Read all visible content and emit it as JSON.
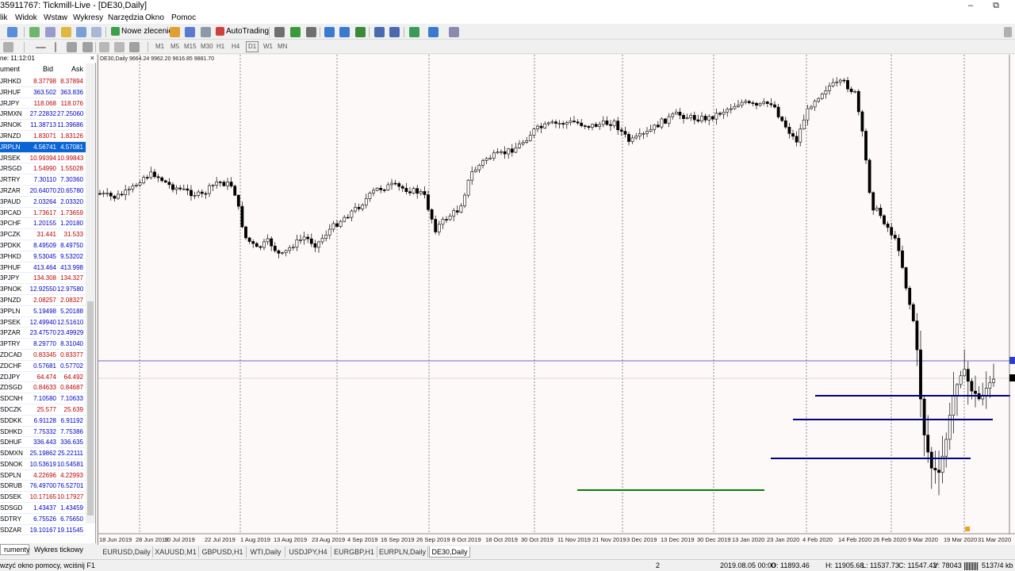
{
  "window": {
    "title": "35911767: Tickmill-Live - [DE30,Daily]",
    "minimize": "–",
    "maximize": "⧉"
  },
  "menu": [
    "lik",
    "Widok",
    "Wstaw",
    "Wykresy",
    "Narzędzia",
    "Okno",
    "Pomoc"
  ],
  "toolbar": {
    "new_order": "Nowe zlecenie",
    "autotrading": "AutoTrading",
    "timeframes": [
      "M1",
      "M5",
      "M15",
      "M30",
      "H1",
      "H4",
      "D1",
      "W1",
      "MN"
    ]
  },
  "market_watch": {
    "header": "ne: 11:12:01",
    "close": "×",
    "col_symbol": "ument",
    "col_bid": "Bid",
    "col_ask": "Ask",
    "rows": [
      {
        "symbol": "JRHKD",
        "bid": "8.37798",
        "ask": "8.37894",
        "dir": "down"
      },
      {
        "symbol": "JRHUF",
        "bid": "363.502",
        "ask": "363.836",
        "dir": "up"
      },
      {
        "symbol": "JRJPY",
        "bid": "118.068",
        "ask": "118.076",
        "dir": "down"
      },
      {
        "symbol": "JRMXN",
        "bid": "27.22832",
        "ask": "27.25060",
        "dir": "up"
      },
      {
        "symbol": "JRNOK",
        "bid": "11.38713",
        "ask": "11.39686",
        "dir": "up"
      },
      {
        "symbol": "JRNZD",
        "bid": "1.83071",
        "ask": "1.83126",
        "dir": "down"
      },
      {
        "symbol": "JRPLN",
        "bid": "4.56741",
        "ask": "4.57081",
        "dir": "sel"
      },
      {
        "symbol": "JRSEK",
        "bid": "10.99394",
        "ask": "10.99843",
        "dir": "down"
      },
      {
        "symbol": "JRSGD",
        "bid": "1.54990",
        "ask": "1.55028",
        "dir": "down"
      },
      {
        "symbol": "JRTRY",
        "bid": "7.30110",
        "ask": "7.30360",
        "dir": "up"
      },
      {
        "symbol": "JRZAR",
        "bid": "20.64070",
        "ask": "20.65780",
        "dir": "up"
      },
      {
        "symbol": "3PAUD",
        "bid": "2.03264",
        "ask": "2.03320",
        "dir": "up"
      },
      {
        "symbol": "3PCAD",
        "bid": "1.73617",
        "ask": "1.73659",
        "dir": "down"
      },
      {
        "symbol": "3PCHF",
        "bid": "1.20155",
        "ask": "1.20180",
        "dir": "up"
      },
      {
        "symbol": "3PCZK",
        "bid": "31.441",
        "ask": "31.533",
        "dir": "down"
      },
      {
        "symbol": "3PDKK",
        "bid": "8.49509",
        "ask": "8.49750",
        "dir": "up"
      },
      {
        "symbol": "3PHKD",
        "bid": "9.53045",
        "ask": "9.53202",
        "dir": "up"
      },
      {
        "symbol": "3PHUF",
        "bid": "413.464",
        "ask": "413.998",
        "dir": "up"
      },
      {
        "symbol": "3PJPY",
        "bid": "134.308",
        "ask": "134.327",
        "dir": "down"
      },
      {
        "symbol": "3PNOK",
        "bid": "12.92550",
        "ask": "12.97580",
        "dir": "up"
      },
      {
        "symbol": "3PNZD",
        "bid": "2.08257",
        "ask": "2.08327",
        "dir": "down"
      },
      {
        "symbol": "3PPLN",
        "bid": "5.19498",
        "ask": "5.20188",
        "dir": "up"
      },
      {
        "symbol": "3PSEK",
        "bid": "12.49940",
        "ask": "12.51610",
        "dir": "up"
      },
      {
        "symbol": "3PZAR",
        "bid": "23.47570",
        "ask": "23.49929",
        "dir": "up"
      },
      {
        "symbol": "3PTRY",
        "bid": "8.29770",
        "ask": "8.31040",
        "dir": "up"
      },
      {
        "symbol": "ZDCAD",
        "bid": "0.83345",
        "ask": "0.83377",
        "dir": "down"
      },
      {
        "symbol": "ZDCHF",
        "bid": "0.57681",
        "ask": "0.57702",
        "dir": "up"
      },
      {
        "symbol": "ZDJPY",
        "bid": "64.474",
        "ask": "64.492",
        "dir": "down"
      },
      {
        "symbol": "ZDSGD",
        "bid": "0.84633",
        "ask": "0.84687",
        "dir": "down"
      },
      {
        "symbol": "SDCNH",
        "bid": "7.10580",
        "ask": "7.10633",
        "dir": "up"
      },
      {
        "symbol": "SDCZK",
        "bid": "25.577",
        "ask": "25.639",
        "dir": "down"
      },
      {
        "symbol": "SDDKK",
        "bid": "6.91128",
        "ask": "6.91192",
        "dir": "up"
      },
      {
        "symbol": "SDHKD",
        "bid": "7.75332",
        "ask": "7.75386",
        "dir": "up"
      },
      {
        "symbol": "SDHUF",
        "bid": "336.443",
        "ask": "336.635",
        "dir": "up"
      },
      {
        "symbol": "SDMXN",
        "bid": "25.19862",
        "ask": "25.22111",
        "dir": "up"
      },
      {
        "symbol": "SDNOK",
        "bid": "10.53619",
        "ask": "10.54581",
        "dir": "up"
      },
      {
        "symbol": "SDPLN",
        "bid": "4.22696",
        "ask": "4.22993",
        "dir": "down"
      },
      {
        "symbol": "SDRUB",
        "bid": "76.49700",
        "ask": "76.52701",
        "dir": "up"
      },
      {
        "symbol": "SDSEK",
        "bid": "10.17165",
        "ask": "10.17927",
        "dir": "down"
      },
      {
        "symbol": "SDSGD",
        "bid": "1.43437",
        "ask": "1.43459",
        "dir": "up"
      },
      {
        "symbol": "SDTRY",
        "bid": "6.75526",
        "ask": "6.75650",
        "dir": "up"
      },
      {
        "symbol": "SDZAR",
        "bid": "19.10167",
        "ask": "19.11545",
        "dir": "up"
      }
    ],
    "tabs": [
      "rumenty",
      "Wykres tickowy"
    ]
  },
  "chart": {
    "info": "DE30,Daily  9664.24 9962.20 9616.85 9881.70",
    "date_labels": [
      "18 Jun 2019",
      "28 Jun 2019",
      "10 Jul 2019",
      "22 Jul 2019",
      "1 Aug 2019",
      "13 Aug 2019",
      "23 Aug 2019",
      "4 Sep 2019",
      "16 Sep 2019",
      "26 Sep 2019",
      "8 Oct 2019",
      "18 Oct 2019",
      "30 Oct 2019",
      "11 Nov 2019",
      "21 Nov 2019",
      "3 Dec 2019",
      "13 Dec 2019",
      "30 Dec 2019",
      "13 Jan 2020",
      "23 Jan 2020",
      "4 Feb 2020",
      "14 Feb 2020",
      "26 Feb 2020",
      "9 Mar 2020",
      "19 Mar 2020",
      "31 Mar 2020"
    ],
    "colors": {
      "background": "#fdf9f8",
      "candle": "#000000",
      "level_line": "#000080",
      "green_line": "#008000",
      "hline": "#6a6ac8"
    }
  },
  "chart_tabs": [
    "EURUSD,Daily",
    "XAUUSD,M1",
    "GBPUSD,H1",
    "WTI,Daily",
    "USDJPY,H4",
    "EURGBP,H1",
    "EURPLN,Daily",
    "DE30,Daily"
  ],
  "status": {
    "help": "wzyć okno pomocy, wciśnij F1",
    "profile": "2",
    "datetime": "2019.08.05 00:00",
    "open": "O: 11893.46",
    "high": "H: 11905.68",
    "low": "L: 11537.73",
    "close": "C: 11547.42",
    "volume": "V: 78043",
    "traffic": "5137/4 kb"
  }
}
